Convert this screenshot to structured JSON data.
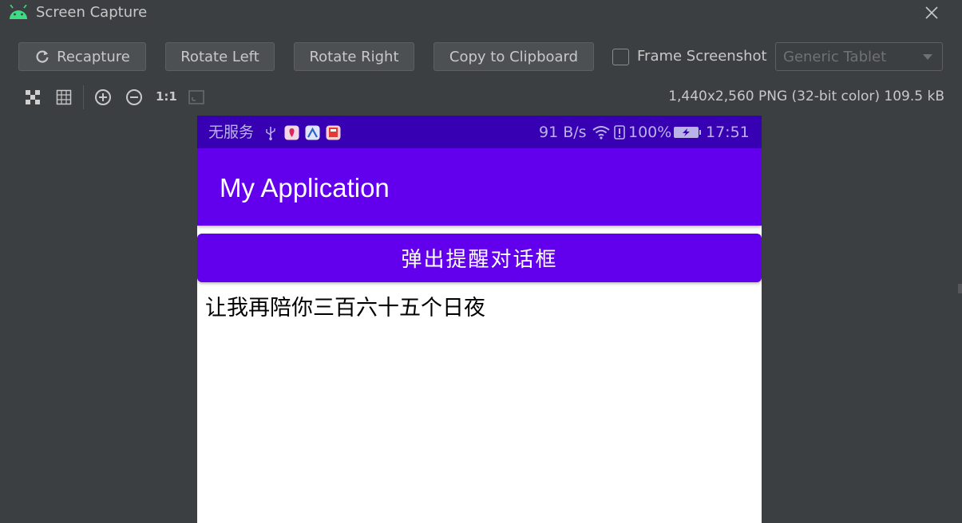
{
  "window": {
    "title": "Screen Capture",
    "icon": "android-icon",
    "close_icon": "close-icon"
  },
  "toolbar": {
    "recapture_label": "Recapture",
    "rotate_left_label": "Rotate Left",
    "rotate_right_label": "Rotate Right",
    "copy_label": "Copy to Clipboard",
    "frame_screenshot_label": "Frame Screenshot",
    "frame_screenshot_checked": false,
    "device_select_value": "Generic Tablet"
  },
  "view_toolbar": {
    "icons": [
      "checkerboard-icon",
      "grid-icon",
      "zoom-in-icon",
      "zoom-out-icon",
      "actual-size-icon",
      "fit-screen-icon"
    ],
    "actual_size_label": "1:1",
    "image_info": "1,440x2,560 PNG (32-bit color) 109.5 kB"
  },
  "device": {
    "status_bar": {
      "carrier": "无服务",
      "net_speed": "91 B/s",
      "battery_pct": "100%",
      "time": "17:51"
    },
    "app_bar": {
      "title": "My Application"
    },
    "button_label": "弹出提醒对话框",
    "body_text": "让我再陪你三百六十五个日夜"
  },
  "colors": {
    "ide_background": "#3c3f41",
    "status_bar": "#3700b3",
    "primary": "#6200ee",
    "android_green": "#3ddc84"
  }
}
